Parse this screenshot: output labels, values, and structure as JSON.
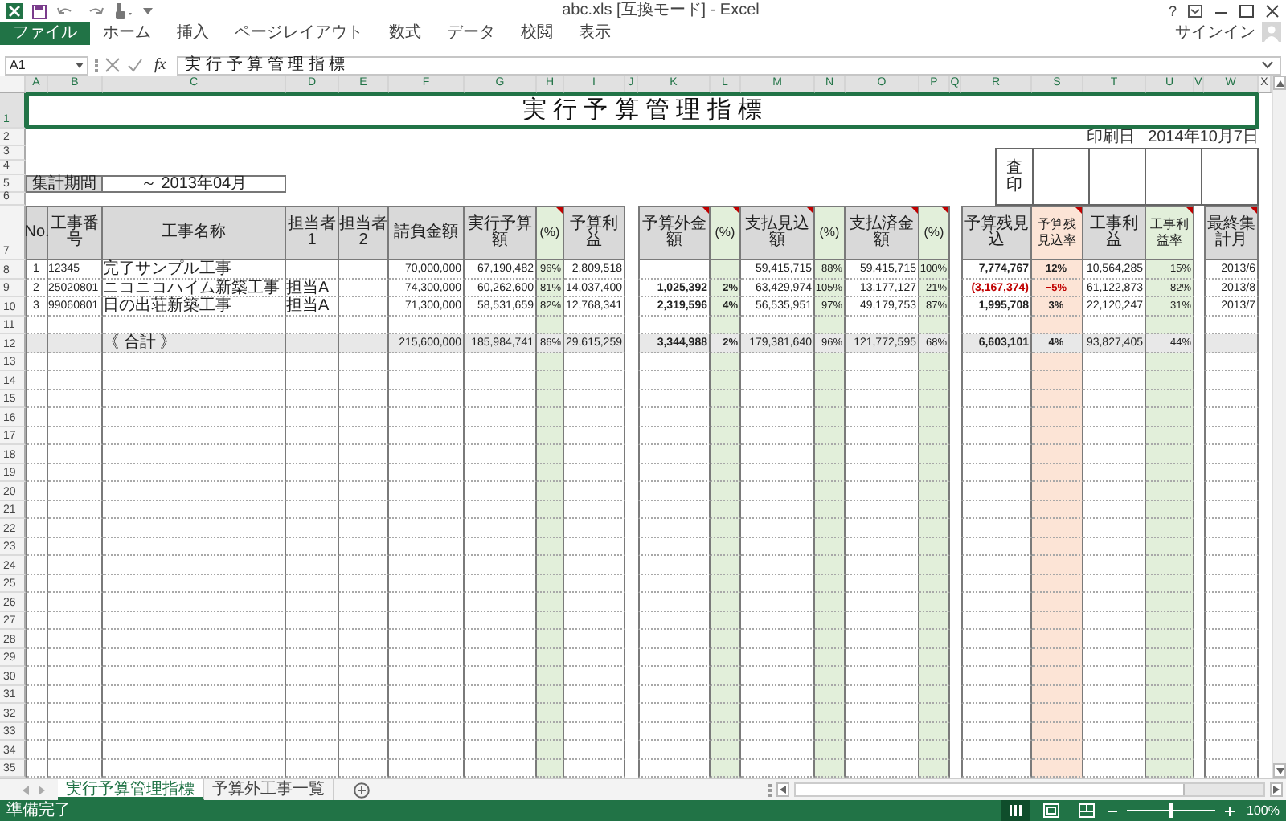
{
  "window": {
    "title": "abc.xls [互換モード] - Excel",
    "help": "?"
  },
  "ribbon_tabs": [
    {
      "label": "ファイル",
      "kind": "file"
    },
    {
      "label": "ホーム",
      "kind": "tab"
    },
    {
      "label": "挿入",
      "kind": "tab"
    },
    {
      "label": "ページレイアウト",
      "kind": "tab"
    },
    {
      "label": "数式",
      "kind": "tab"
    },
    {
      "label": "データ",
      "kind": "tab"
    },
    {
      "label": "校閲",
      "kind": "tab"
    },
    {
      "label": "表示",
      "kind": "tab"
    }
  ],
  "account": {
    "label": "サインイン"
  },
  "formula_bar": {
    "name_box": "A1",
    "function_label": "fx",
    "value": "実 行 予 算 管 理 指 標"
  },
  "column_headers": [
    {
      "label": "A",
      "selected": true
    },
    {
      "label": "B",
      "selected": true
    },
    {
      "label": "C",
      "selected": true
    },
    {
      "label": "D",
      "selected": true
    },
    {
      "label": "E",
      "selected": true
    },
    {
      "label": "F",
      "selected": true
    },
    {
      "label": "G",
      "selected": true
    },
    {
      "label": "H",
      "selected": true
    },
    {
      "label": "I",
      "selected": true
    },
    {
      "label": "J",
      "selected": true
    },
    {
      "label": "K",
      "selected": true
    },
    {
      "label": "L",
      "selected": true
    },
    {
      "label": "M",
      "selected": true
    },
    {
      "label": "N",
      "selected": true
    },
    {
      "label": "O",
      "selected": true
    },
    {
      "label": "P",
      "selected": true
    },
    {
      "label": "Q",
      "selected": true
    },
    {
      "label": "R",
      "selected": true
    },
    {
      "label": "S",
      "selected": true
    },
    {
      "label": "T",
      "selected": true
    },
    {
      "label": "U",
      "selected": true
    },
    {
      "label": "V",
      "selected": true
    },
    {
      "label": "W",
      "selected": true
    },
    {
      "label": "X",
      "selected": false
    }
  ],
  "row_numbers": [
    {
      "label": "1",
      "selected": true
    },
    {
      "label": "2",
      "selected": false
    },
    {
      "label": "3",
      "selected": false
    },
    {
      "label": "4",
      "selected": false
    },
    {
      "label": "5",
      "selected": false
    },
    {
      "label": "6",
      "selected": false
    },
    {
      "label": "7",
      "selected": false
    },
    {
      "label": "8",
      "selected": false
    },
    {
      "label": "9",
      "selected": false
    },
    {
      "label": "10",
      "selected": false
    },
    {
      "label": "11",
      "selected": false
    },
    {
      "label": "12",
      "selected": false
    },
    {
      "label": "13",
      "selected": false
    },
    {
      "label": "14",
      "selected": false
    },
    {
      "label": "15",
      "selected": false
    },
    {
      "label": "16",
      "selected": false
    },
    {
      "label": "17",
      "selected": false
    },
    {
      "label": "18",
      "selected": false
    },
    {
      "label": "19",
      "selected": false
    },
    {
      "label": "20",
      "selected": false
    },
    {
      "label": "21",
      "selected": false
    },
    {
      "label": "22",
      "selected": false
    },
    {
      "label": "23",
      "selected": false
    },
    {
      "label": "24",
      "selected": false
    },
    {
      "label": "25",
      "selected": false
    },
    {
      "label": "26",
      "selected": false
    },
    {
      "label": "27",
      "selected": false
    },
    {
      "label": "28",
      "selected": false
    },
    {
      "label": "29",
      "selected": false
    },
    {
      "label": "30",
      "selected": false
    },
    {
      "label": "31",
      "selected": false
    },
    {
      "label": "32",
      "selected": false
    },
    {
      "label": "33",
      "selected": false
    },
    {
      "label": "34",
      "selected": false
    },
    {
      "label": "35",
      "selected": false
    }
  ],
  "sheet": {
    "title": "実 行 予 算 管 理 指 標",
    "print_date_label": "印刷日",
    "print_date": "2014年10月7日",
    "stamp_label": "査印",
    "period_label": "集計期間",
    "period_value": "～ 2013年04月"
  },
  "table": {
    "columns": [
      {
        "label": "No.",
        "kind": "index",
        "comment": false
      },
      {
        "label": "工事番号",
        "kind": "code",
        "comment": false
      },
      {
        "label": "工事名称",
        "kind": "text",
        "comment": false
      },
      {
        "label": "担当者1",
        "kind": "text",
        "comment": false
      },
      {
        "label": "担当者2",
        "kind": "text",
        "comment": false
      },
      {
        "label": "請負金額",
        "kind": "amount",
        "comment": false
      },
      {
        "label": "実行予算額",
        "kind": "amount",
        "comment": false
      },
      {
        "label": "(%)",
        "kind": "percent",
        "comment": true
      },
      {
        "label": "予算利益",
        "kind": "amount",
        "comment": false
      },
      {
        "label": "予算外金額",
        "kind": "key_amount",
        "comment": true
      },
      {
        "label": "(%)",
        "kind": "key_percent",
        "comment": true
      },
      {
        "label": "支払見込額",
        "kind": "amount",
        "comment": true
      },
      {
        "label": "(%)",
        "kind": "percent",
        "comment": false
      },
      {
        "label": "支払済金額",
        "kind": "amount",
        "comment": true
      },
      {
        "label": "(%)",
        "kind": "percent",
        "comment": true
      },
      {
        "label": "予算残見込",
        "kind": "forecast_amount",
        "comment": false
      },
      {
        "label": "予算残見込率",
        "kind": "forecast_percent",
        "comment": true
      },
      {
        "label": "工事利益",
        "kind": "amount",
        "comment": false
      },
      {
        "label": "工事利益率",
        "kind": "percent",
        "comment": true
      },
      {
        "label": "最終集計月",
        "kind": "month",
        "comment": true
      }
    ],
    "rows": [
      {
        "kind": "item",
        "negative": false,
        "cells": [
          "1",
          "12345",
          "完了サンプル工事",
          null,
          null,
          "70,000,000",
          "67,190,482",
          "96%",
          "2,809,518",
          null,
          null,
          "59,415,715",
          "88%",
          "59,415,715",
          "100%",
          "7,774,767",
          "12%",
          "10,564,285",
          "15%",
          "2013/6"
        ]
      },
      {
        "kind": "item",
        "negative": true,
        "cells": [
          "2",
          "25020801",
          "ニコニコハイム新築工事",
          "担当A",
          null,
          "74,300,000",
          "60,262,600",
          "81%",
          "14,037,400",
          "1,025,392",
          "2%",
          "63,429,974",
          "105%",
          "13,177,127",
          "21%",
          "(3,167,374)",
          "−5%",
          "61,122,873",
          "82%",
          "2013/8"
        ]
      },
      {
        "kind": "item",
        "negative": false,
        "cells": [
          "3",
          "99060801",
          "日の出荘新築工事",
          "担当A",
          null,
          "71,300,000",
          "58,531,659",
          "82%",
          "12,768,341",
          "2,319,596",
          "4%",
          "56,535,951",
          "97%",
          "49,179,753",
          "87%",
          "1,995,708",
          "3%",
          "22,120,247",
          "31%",
          "2013/7"
        ]
      },
      {
        "kind": "blank"
      },
      {
        "kind": "total",
        "cells": [
          null,
          null,
          "《 合計 》",
          null,
          null,
          "215,600,000",
          "185,984,741",
          "86%",
          "29,615,259",
          "3,344,988",
          "2%",
          "179,381,640",
          "96%",
          "121,772,595",
          "68%",
          "6,603,101",
          "4%",
          "93,827,405",
          "44%",
          null
        ]
      }
    ]
  },
  "sheet_tabs": [
    {
      "label": "実行予算管理指標",
      "selected": true
    },
    {
      "label": "予算外工事一覧",
      "selected": false
    }
  ],
  "status_bar": {
    "text": "準備完了",
    "views": [
      {
        "kind": "normal",
        "selected": true
      },
      {
        "kind": "page_layout",
        "selected": false
      },
      {
        "kind": "page_break",
        "selected": false
      }
    ],
    "zoom": {
      "level": 0.5,
      "label": "100%"
    }
  }
}
